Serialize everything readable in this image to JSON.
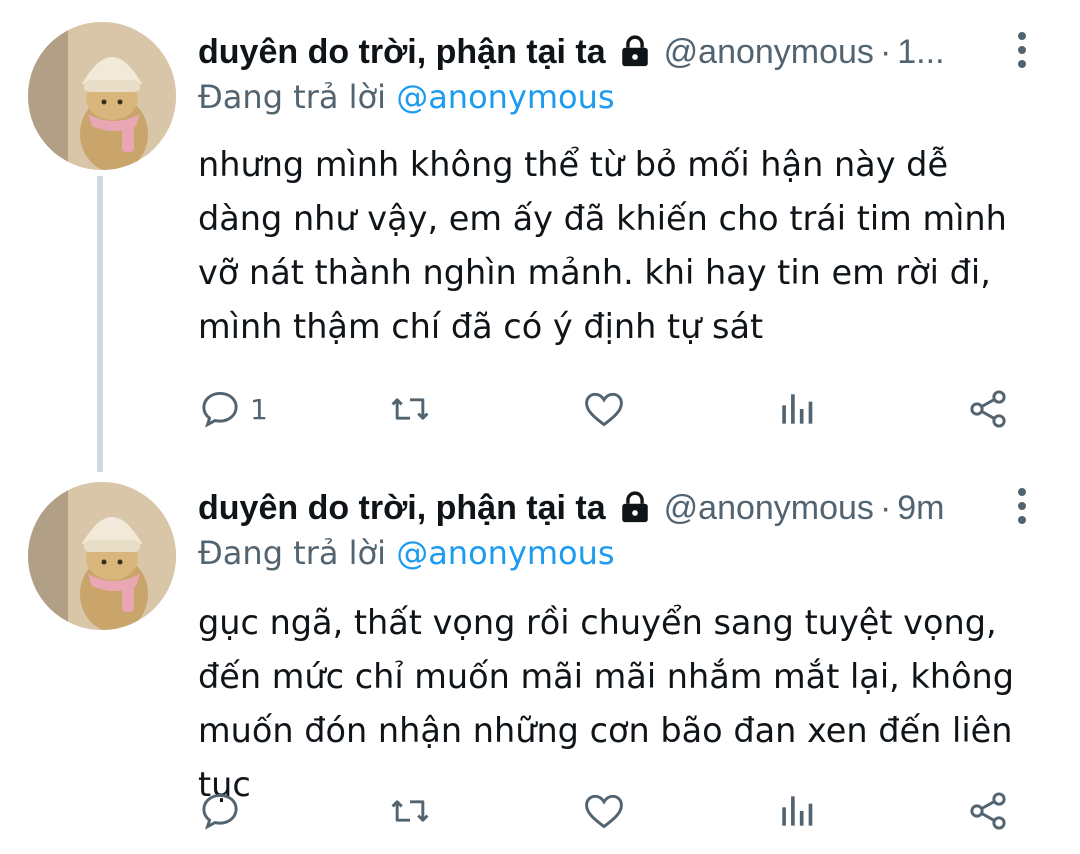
{
  "tweets": [
    {
      "display_name": "duyên do trời, phận tại ta",
      "handle": "@anonymous",
      "separator": "·",
      "time": "1...",
      "replying_prefix": "Đang trả lời",
      "replying_to": "@anonymous",
      "text": "nhưng mình không thể từ bỏ mối hận này dễ dàng như vậy, em ấy đã khiến cho trái tim mình vỡ nát thành nghìn mảnh. khi hay tin em rời đi, mình thậm chí đã có ý định tự sát",
      "reply_count": "1"
    },
    {
      "display_name": "duyên do trời, phận tại ta",
      "handle": "@anonymous",
      "separator": "·",
      "time": "9m",
      "replying_prefix": "Đang trả lời",
      "replying_to": "@anonymous",
      "text": "gục ngã, thất vọng rồi chuyển sang tuyệt vọng, đến mức chỉ muốn mãi mãi nhắm mắt lại, không muốn đón nhận những cơn bão đan xen đến liên tục",
      "reply_count": ""
    }
  ],
  "icons": {
    "verified_lock": "lock-icon",
    "more": "more-vertical-icon",
    "reply": "reply-icon",
    "retweet": "retweet-icon",
    "like": "heart-icon",
    "views": "analytics-icon",
    "share": "share-icon"
  },
  "colors": {
    "text": "#0f1419",
    "secondary": "#536471",
    "link": "#1d9bf0",
    "thread_line": "#cfd9de",
    "background": "#ffffff"
  }
}
